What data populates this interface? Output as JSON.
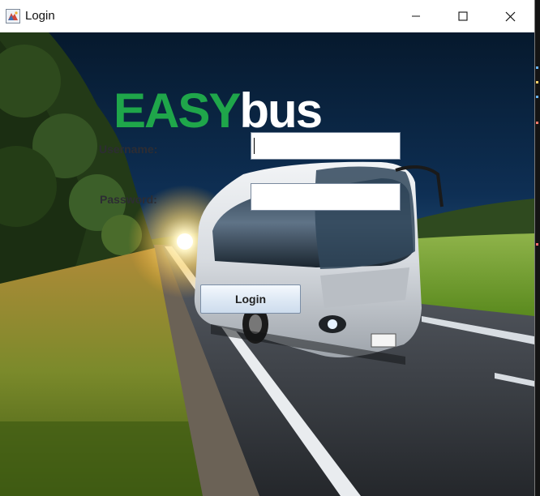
{
  "window": {
    "title": "Login",
    "controls": {
      "minimize": "minimize-icon",
      "maximize": "maximize-icon",
      "close": "close-icon"
    }
  },
  "brand": {
    "part1": "EASY",
    "part2": "bus",
    "part1_color": "#1fa64a",
    "part2_color": "#ffffff"
  },
  "form": {
    "username_label": "Username:",
    "username_value": "",
    "password_label": "Password:",
    "password_value": "",
    "login_label": "Login"
  },
  "background": {
    "scene": "bus-on-road-at-sunset"
  }
}
